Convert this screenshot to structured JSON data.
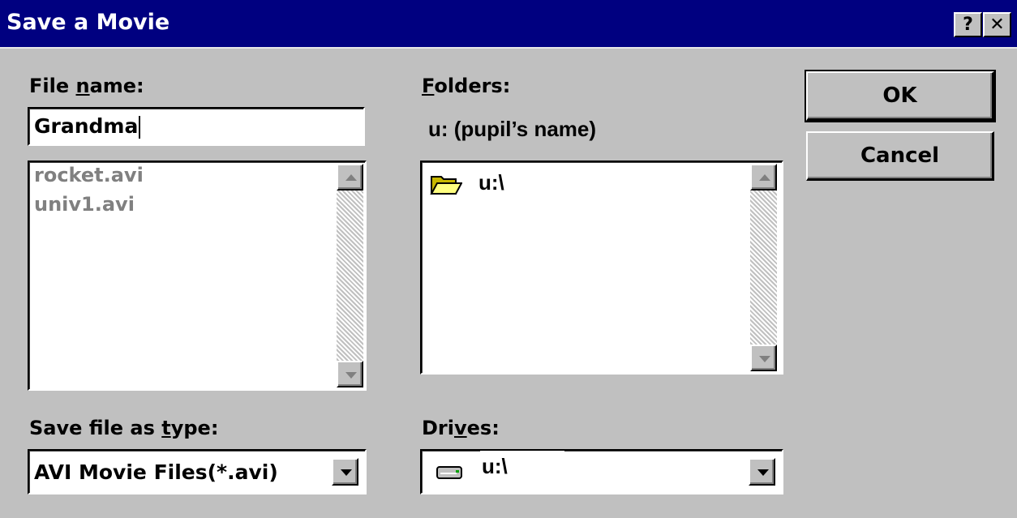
{
  "window": {
    "title": "Save a Movie",
    "help_button": "?",
    "close_button": "✕"
  },
  "file_name": {
    "label_before": "File ",
    "label_accel": "n",
    "label_after": "ame:",
    "value": "Grandma",
    "files": [
      "rocket.avi",
      "univ1.avi"
    ]
  },
  "folders": {
    "label_accel": "F",
    "label_after": "olders:",
    "current_path": "u: (pupil’s name)",
    "items": [
      "u:\\"
    ]
  },
  "save_type": {
    "label_before": "Save file as ",
    "label_accel": "t",
    "label_after": "ype:",
    "selected": "AVI Movie Files(*.avi)"
  },
  "drives": {
    "label_before": "Dri",
    "label_accel": "v",
    "label_after": "es:",
    "selected": "u:\\"
  },
  "buttons": {
    "ok": "OK",
    "cancel": "Cancel"
  },
  "icons": {
    "folder": "open-folder-icon",
    "drive": "network-drive-icon"
  }
}
